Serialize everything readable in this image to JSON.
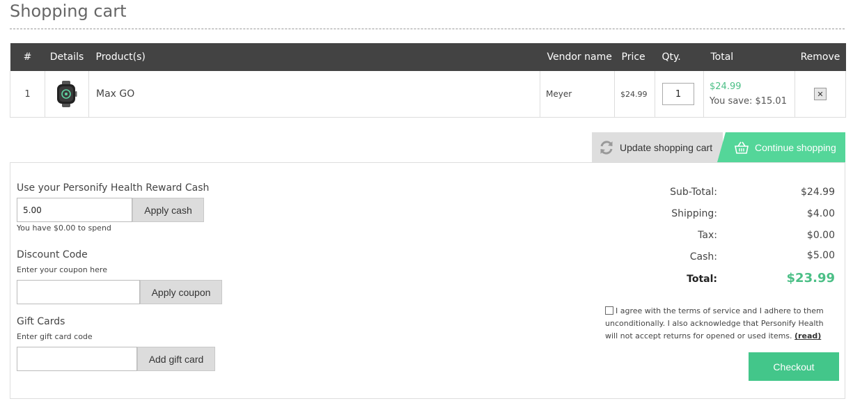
{
  "page": {
    "title": "Shopping cart"
  },
  "table": {
    "headers": {
      "index": "#",
      "details": "Details",
      "products": "Product(s)",
      "vendor": "Vendor name",
      "price": "Price",
      "qty": "Qty.",
      "total": "Total",
      "remove": "Remove"
    },
    "rows": [
      {
        "index": "1",
        "product_icon": "smartwatch-icon",
        "product_name": "Max GO",
        "vendor": "Meyer",
        "price": "$24.99",
        "qty": "1",
        "total": "$24.99",
        "you_save": "You save: $15.01",
        "remove_glyph": "✕"
      }
    ]
  },
  "actions": {
    "update_cart": "Update shopping cart",
    "update_icon": "refresh-icon",
    "continue_shopping": "Continue shopping",
    "continue_icon": "basket-icon"
  },
  "reward_cash": {
    "title": "Use your Personify Health Reward Cash",
    "value": "5.00",
    "button": "Apply cash",
    "hint": "You have $0.00 to spend"
  },
  "discount": {
    "title": "Discount Code",
    "hint": "Enter your coupon here",
    "value": "",
    "button": "Apply coupon"
  },
  "gift_cards": {
    "title": "Gift Cards",
    "hint": "Enter gift card code",
    "value": "",
    "button": "Add gift card"
  },
  "totals": {
    "subtotal_label": "Sub-Total:",
    "subtotal_value": "$24.99",
    "shipping_label": "Shipping:",
    "shipping_value": "$4.00",
    "tax_label": "Tax:",
    "tax_value": "$0.00",
    "cash_label": "Cash:",
    "cash_value": "$5.00",
    "total_label": "Total:",
    "total_value": "$23.99"
  },
  "terms": {
    "text": "I agree with the terms of service and I adhere to them unconditionally. I also acknowledge that Personify Health will not accept returns for opened or used items.",
    "link": "(read)",
    "checked": false
  },
  "checkout": {
    "button": "Checkout"
  },
  "colors": {
    "accent": "#4bbf86",
    "header_bg": "#434343",
    "button_gray": "#dcdcdc"
  }
}
